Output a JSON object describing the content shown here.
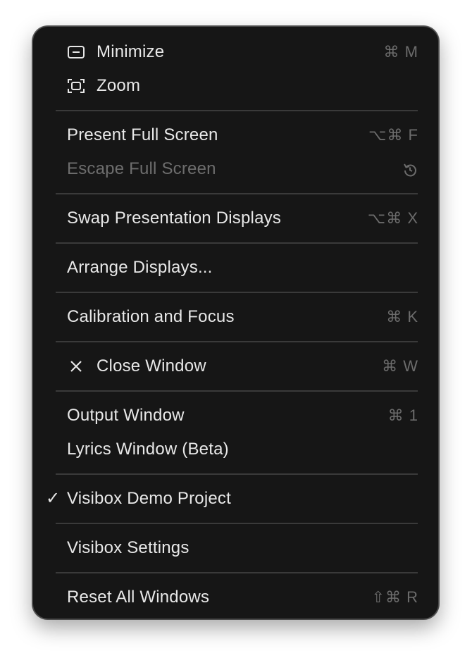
{
  "menu": {
    "items": [
      {
        "label": "Minimize",
        "shortcut": "⌘ M",
        "icon": "minimize-icon"
      },
      {
        "label": "Zoom",
        "shortcut": "",
        "icon": "zoom-icon"
      },
      {
        "label": "Present Full Screen",
        "shortcut": "⌥⌘ F"
      },
      {
        "label": "Escape Full Screen",
        "shortcut": "",
        "shortcut_icon": "revert-icon",
        "disabled": true
      },
      {
        "label": "Swap Presentation Displays",
        "shortcut": "⌥⌘ X"
      },
      {
        "label": "Arrange Displays...",
        "shortcut": ""
      },
      {
        "label": "Calibration and Focus",
        "shortcut": "⌘ K"
      },
      {
        "label": "Close Window",
        "shortcut": "⌘ W",
        "icon": "close-icon"
      },
      {
        "label": "Output Window",
        "shortcut": "⌘ 1"
      },
      {
        "label": "Lyrics Window (Beta)",
        "shortcut": ""
      },
      {
        "label": "Visibox Demo Project",
        "shortcut": "",
        "checked": true,
        "check_glyph": "✓"
      },
      {
        "label": "Visibox Settings",
        "shortcut": ""
      },
      {
        "label": "Reset All Windows",
        "shortcut": "⇧⌘ R"
      }
    ]
  },
  "colors": {
    "background": "#161616",
    "text": "#e8e8e8",
    "disabled_text": "#6d6d6d",
    "shortcut_text": "#6c6c6c",
    "separator": "#3a3a3a",
    "border": "#4a4a4a"
  }
}
